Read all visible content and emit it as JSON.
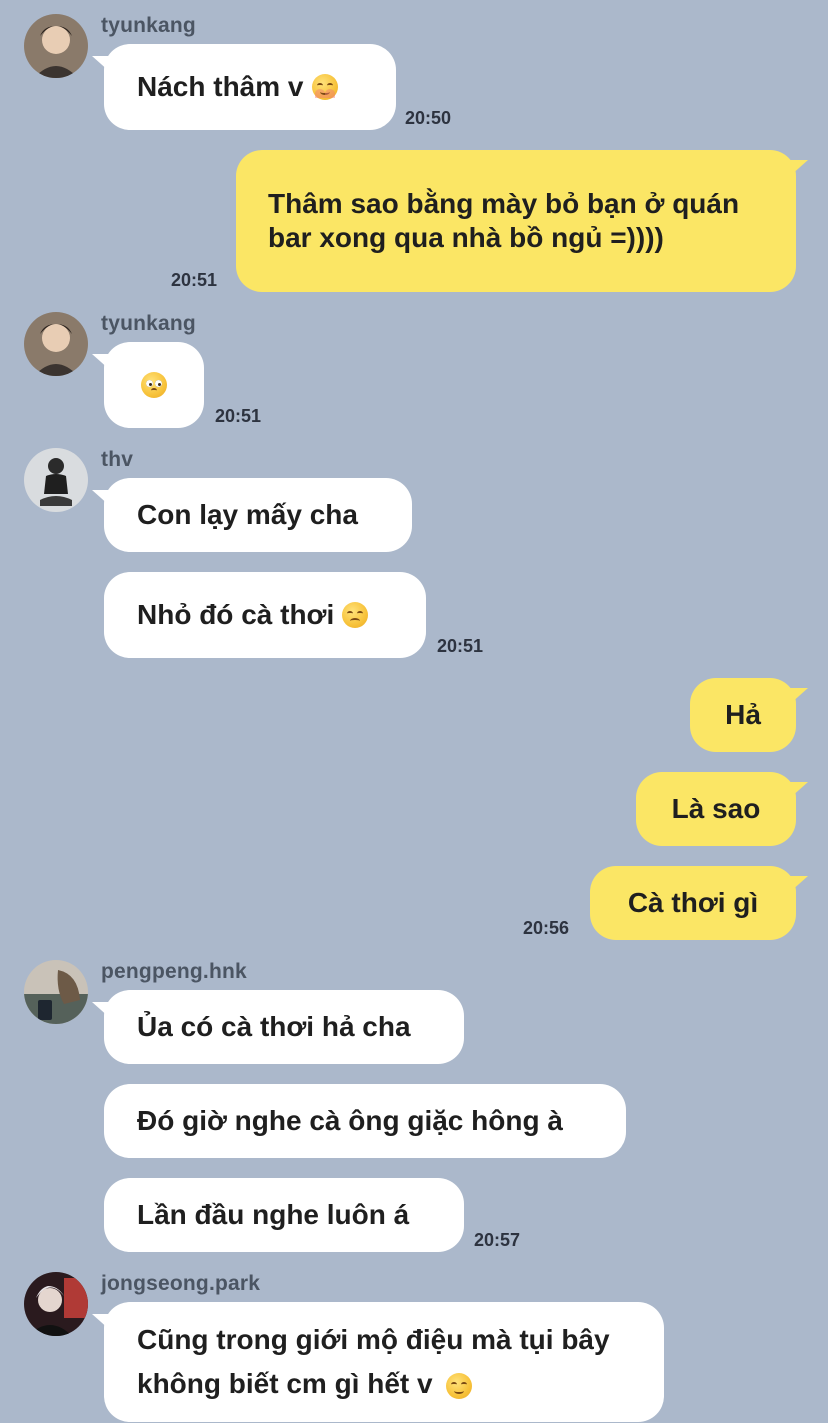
{
  "messages": [
    {
      "sender": "tyunkang",
      "avatar": "tyunkang-avatar",
      "text": "Nách thâm v",
      "emoji": "smiling-face-emoji",
      "time": "20:50"
    },
    {
      "sender": "me",
      "text": "Thâm sao bằng mày bỏ bạn ở quán bar xong qua nhà bồ ngủ =))))",
      "time": "20:51"
    },
    {
      "sender": "tyunkang",
      "avatar": "tyunkang-avatar",
      "text": "",
      "emoji": "pleading-face-emoji",
      "time": "20:51"
    },
    {
      "sender": "thv",
      "avatar": "thv-avatar",
      "text": "Con lạy mấy cha"
    },
    {
      "sender": "thv",
      "text": "Nhỏ đó cà thơi",
      "emoji": "disappointed-face-emoji",
      "time": "20:51"
    },
    {
      "sender": "me",
      "text": "Hả"
    },
    {
      "sender": "me",
      "text": "Là sao"
    },
    {
      "sender": "me",
      "text": "Cà thơi gì",
      "time": "20:56"
    },
    {
      "sender": "pengpeng.hnk",
      "avatar": "pengpeng-avatar",
      "text": "Ủa có cà thơi hả cha"
    },
    {
      "sender": "pengpeng.hnk",
      "text": "Đó giờ nghe cà ông giặc hông à"
    },
    {
      "sender": "pengpeng.hnk",
      "text": "Lần đầu nghe luôn á",
      "time": "20:57"
    },
    {
      "sender": "jongseong.park",
      "avatar": "jongseong-avatar",
      "text": "Cũng trong giới mộ điệu mà tụi bây không biết cm gì hết v",
      "emoji": "unamused-face-emoji"
    }
  ],
  "colors": {
    "background": "#abb8cb",
    "incoming_bubble": "#ffffff",
    "outgoing_bubble": "#fbe665",
    "time_text": "#2d3340",
    "sender_text": "#4b5563"
  }
}
